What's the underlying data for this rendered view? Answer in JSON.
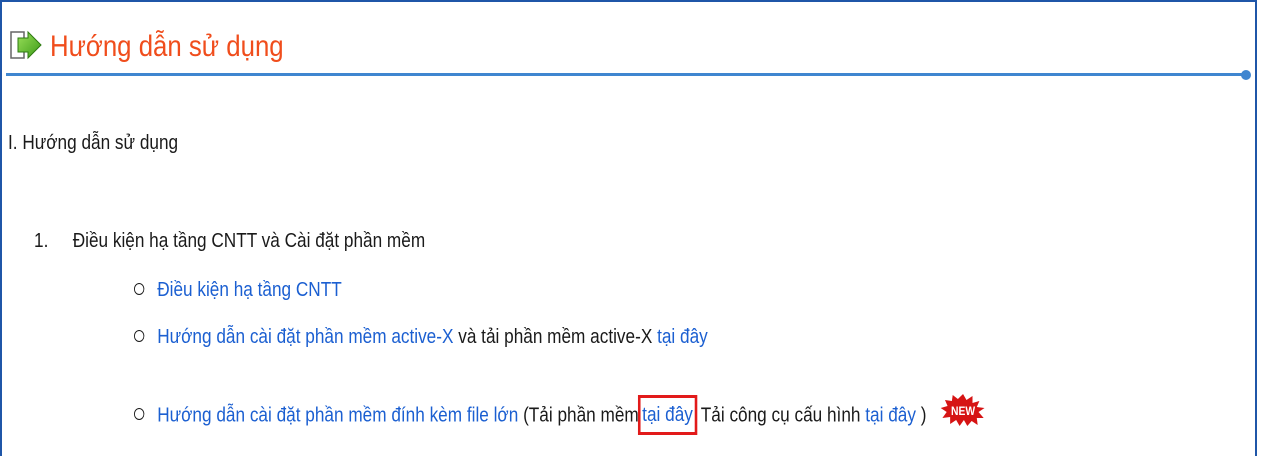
{
  "header": {
    "title": "Hướng dẫn sử dụng",
    "icon": "arrow-right-icon",
    "accent_color": "#f04d1c"
  },
  "section": {
    "title": "I. Hướng dẫn sử dụng"
  },
  "items": [
    {
      "number": "1.",
      "label": "Điều kiện hạ tầng CNTT và Cài đặt phần mềm",
      "sub_items": [
        {
          "link": "Điều kiện hạ tầng CNTT"
        },
        {
          "link": "Hướng dẫn cài đặt phần mềm active-X",
          "text": "và tải phần mềm active-X",
          "link2": "tại đây"
        },
        {
          "link": "Hướng dẫn cài đặt phần mềm đính kèm file lớn",
          "text_open": "(Tải phần mềm",
          "link2": "tại đây",
          "text_mid": "Tải công cụ cấu hình",
          "link3": "tại đây",
          "text_close": ")",
          "badge": "NEW",
          "badge_icon": "new-badge-icon"
        }
      ]
    }
  ],
  "colors": {
    "link": "#1b5fd1",
    "frame": "#1f56a8",
    "divider": "#3f86d0",
    "highlight": "#e21a1a"
  }
}
